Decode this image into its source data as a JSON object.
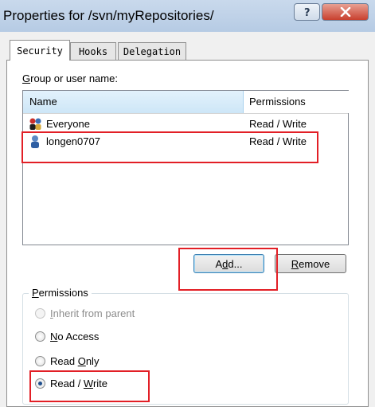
{
  "window": {
    "title": "Properties for /svn/myRepositories/",
    "help_label": "?",
    "close_label": "x"
  },
  "tabs": [
    {
      "label": "Security"
    },
    {
      "label": "Hooks"
    },
    {
      "label": "Delegation"
    }
  ],
  "security": {
    "group_label_prefix": "G",
    "group_label_rest": "roup or user name:",
    "columns": {
      "name": "Name",
      "permissions": "Permissions"
    },
    "rows": [
      {
        "name": "Everyone",
        "permissions": "Read / Write",
        "icon": "group-icon"
      },
      {
        "name": "longen0707",
        "permissions": "Read / Write",
        "icon": "user-icon"
      }
    ],
    "add_button": {
      "pre": "A",
      "ul": "d",
      "post": "d..."
    },
    "remove_button": {
      "ul": "R",
      "post": "emove"
    }
  },
  "permissions": {
    "legend_ul": "P",
    "legend_post": "ermissions",
    "options": [
      {
        "ul": "I",
        "post": "nherit from parent",
        "state": "disabled"
      },
      {
        "ul": "N",
        "post": "o Access",
        "state": "unchecked"
      },
      {
        "pre": "Read ",
        "ul": "O",
        "post": "nly",
        "state": "unchecked"
      },
      {
        "pre": "Read / ",
        "ul": "W",
        "post": "rite",
        "state": "checked"
      }
    ]
  },
  "annotation_color": "#e21f26"
}
